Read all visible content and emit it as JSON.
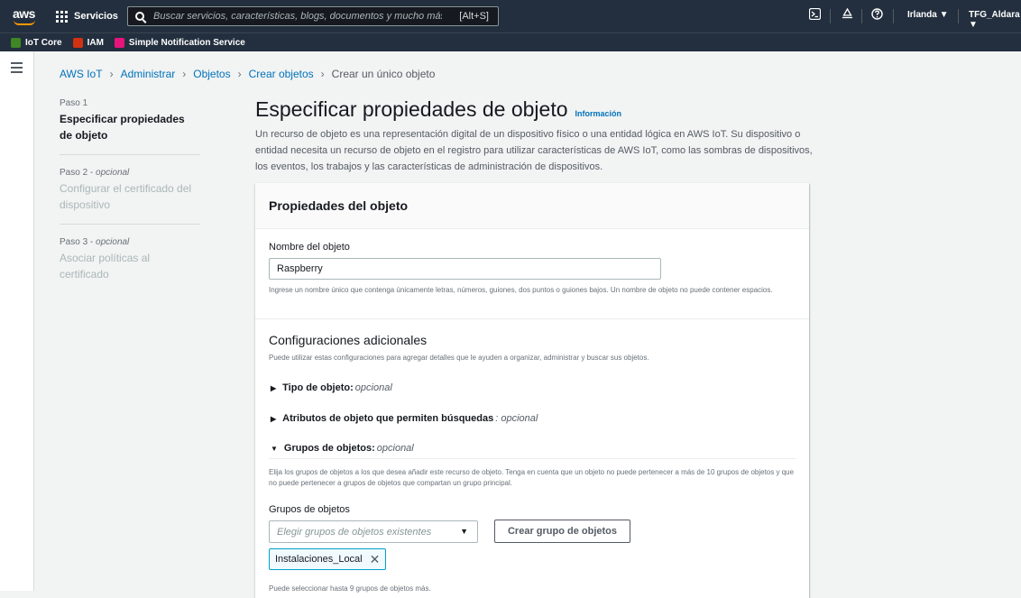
{
  "topnav": {
    "logo": "aws",
    "services_label": "Servicios",
    "search_placeholder": "Buscar servicios, características, blogs, documentos y mucho más",
    "search_shortcut": "[Alt+S]",
    "region": "Irlanda ▼",
    "account": "TFG_Aldara ▼"
  },
  "favorites": [
    {
      "label": "IoT Core",
      "color": "#3f8624"
    },
    {
      "label": "IAM",
      "color": "#d13212"
    },
    {
      "label": "Simple Notification Service",
      "color": "#e7157b"
    }
  ],
  "breadcrumb": {
    "items": [
      "AWS IoT",
      "Administrar",
      "Objetos",
      "Crear objetos"
    ],
    "current": "Crear un único objeto"
  },
  "steps": [
    {
      "label": "Paso 1",
      "title": "Especificar propiedades de objeto"
    },
    {
      "label": "Paso 2",
      "optional": "opcional",
      "title": "Configurar el certificado del dispositivo"
    },
    {
      "label": "Paso 3",
      "optional": "opcional",
      "title": "Asociar políticas al certificado"
    }
  ],
  "page": {
    "title": "Especificar propiedades de objeto",
    "info": "Información",
    "description": "Un recurso de objeto es una representación digital de un dispositivo físico o una entidad lógica en AWS IoT. Su dispositivo o entidad necesita un recurso de objeto en el registro para utilizar características de AWS IoT, como las sombras de dispositivos, los eventos, los trabajos y las características de administración de dispositivos."
  },
  "panel": {
    "title": "Propiedades del objeto",
    "name_label": "Nombre del objeto",
    "name_value": "Raspberry",
    "name_hint": "Ingrese un nombre único que contenga únicamente letras, números, guiones, dos puntos o guiones bajos. Un nombre de objeto no puede contener espacios.",
    "additional_title": "Configuraciones adicionales",
    "additional_desc": "Puede utilizar estas configuraciones para agregar detalles que le ayuden a organizar, administrar y buscar sus objetos.",
    "type_label": "Tipo de objeto:",
    "type_optional": "opcional",
    "attrs_label": "Atributos de objeto que permiten búsquedas",
    "attrs_optional": ": opcional",
    "groups_label": "Grupos de objetos:",
    "groups_optional": "opcional",
    "groups_desc": "Elija los grupos de objetos a los que desea añadir este recurso de objeto. Tenga en cuenta que un objeto no puede pertenecer a más de 10 grupos de objetos y que no puede pertenecer a grupos de objetos que compartan un grupo principal.",
    "groups_field_label": "Grupos de objetos",
    "groups_placeholder": "Elegir grupos de objetos existentes",
    "create_group_button": "Crear grupo de objetos",
    "selected_group": "Instalaciones_Local",
    "groups_hint": "Puede seleccionar hasta 9 grupos de objetos más."
  }
}
